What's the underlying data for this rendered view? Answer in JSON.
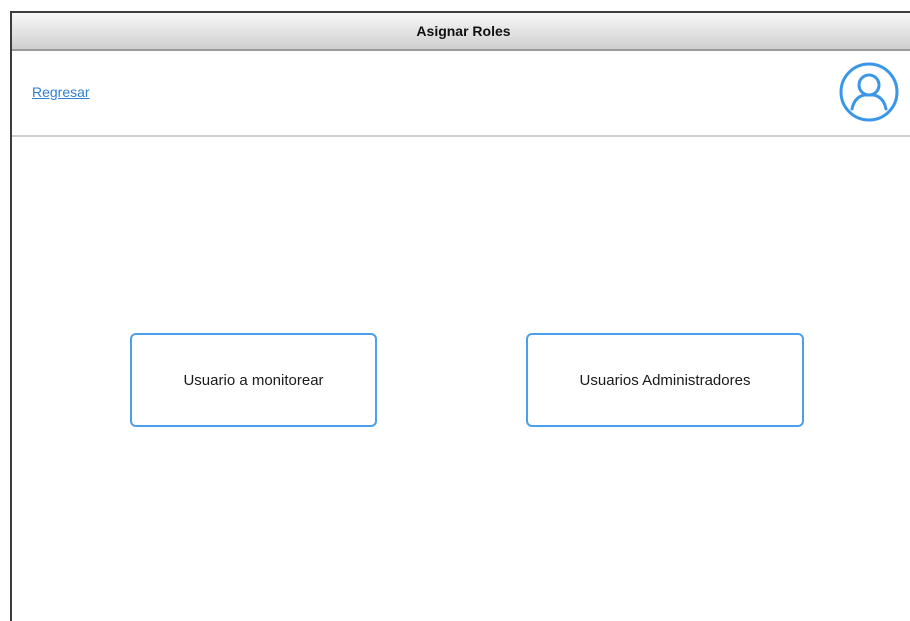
{
  "window": {
    "title": "Asignar Roles"
  },
  "header": {
    "back_link": "Regresar",
    "avatar_icon": "user-avatar-icon"
  },
  "main": {
    "buttons": [
      {
        "label": "Usuario a monitorear"
      },
      {
        "label": "Usuarios Administradores"
      }
    ]
  },
  "colors": {
    "accent": "#4aa0ea",
    "link": "#2f7fd6",
    "titlebar": "#e2e2e2"
  }
}
